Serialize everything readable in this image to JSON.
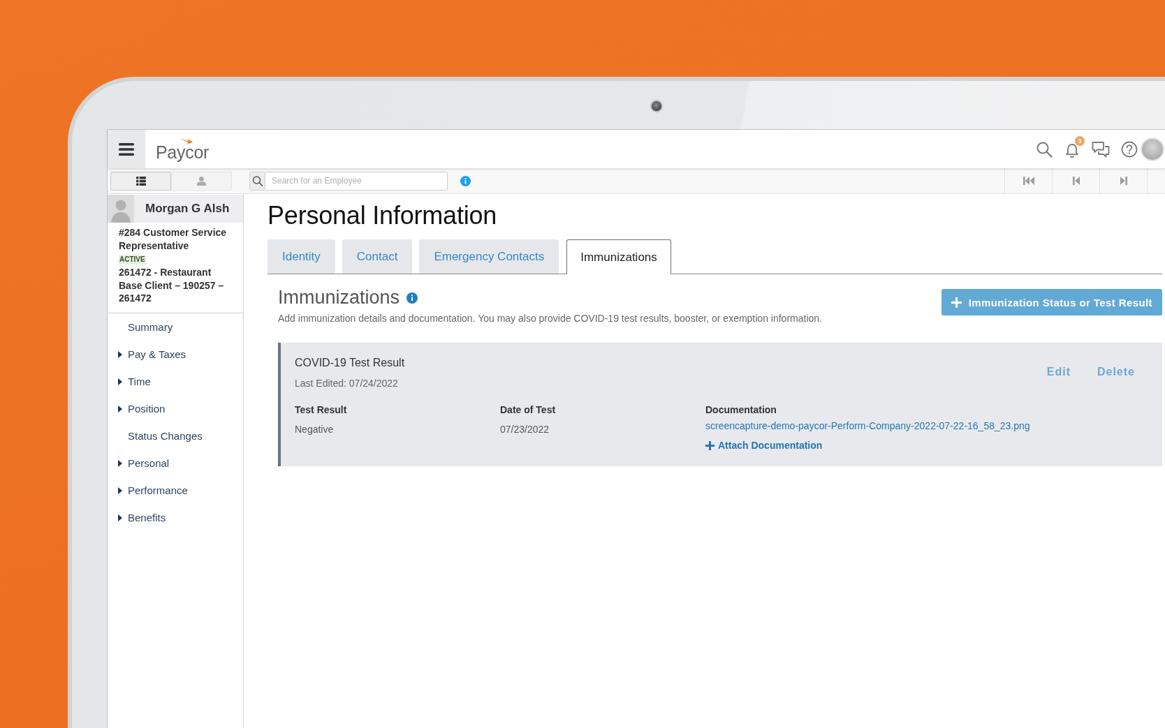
{
  "header": {
    "logo": "Paycor",
    "notification_badge": "3"
  },
  "toolbar": {
    "view_toggles": [
      {
        "kind": "list",
        "selected": true
      },
      {
        "kind": "person",
        "selected": false
      }
    ],
    "search": {
      "placeholder": "Search for an Employee"
    },
    "nav_buttons": [
      {
        "kind": "first"
      },
      {
        "kind": "previous"
      },
      {
        "kind": "next"
      }
    ]
  },
  "employee": {
    "name": "Morgan G Alsh",
    "position": "#284 Customer Service Representative",
    "status": "ACTIVE",
    "company": "261472 - Restaurant Base Client – 190257 – 261472"
  },
  "sidebar": {
    "items": [
      {
        "label": "Summary",
        "kind": "page"
      },
      {
        "label": "Pay & Taxes",
        "kind": "section"
      },
      {
        "label": "Time",
        "kind": "section"
      },
      {
        "label": "Position",
        "kind": "section"
      },
      {
        "label": "Status Changes",
        "kind": "page"
      },
      {
        "label": "Personal",
        "kind": "section"
      },
      {
        "label": "Performance",
        "kind": "section"
      },
      {
        "label": "Benefits",
        "kind": "section"
      }
    ]
  },
  "page": {
    "title": "Personal Information",
    "tabs": [
      {
        "label": "Identity",
        "selected": false
      },
      {
        "label": "Contact",
        "selected": false
      },
      {
        "label": "Emergency Contacts",
        "selected": false
      },
      {
        "label": "Immunizations",
        "selected": true
      }
    ]
  },
  "section": {
    "title": "Immunizations",
    "description": "Add immunization details and documentation. You may also provide COVID-19 test results, booster, or exemption information.",
    "add_button": "Immunization Status or Test Result"
  },
  "records": [
    {
      "title": "COVID-19 Test Result",
      "last_edited": "Last Edited: 07/24/2022",
      "actions": [
        "Edit",
        "Delete"
      ],
      "fields": [
        {
          "label": "Test Result",
          "value": "Negative"
        },
        {
          "label": "Date of Test",
          "value": "07/23/2022"
        }
      ],
      "documentation": {
        "label": "Documentation",
        "file": "screencapture-demo-paycor-Perform-Company-2022-07-22-16_58_23.png",
        "attach": "Attach Documentation"
      }
    }
  ]
}
